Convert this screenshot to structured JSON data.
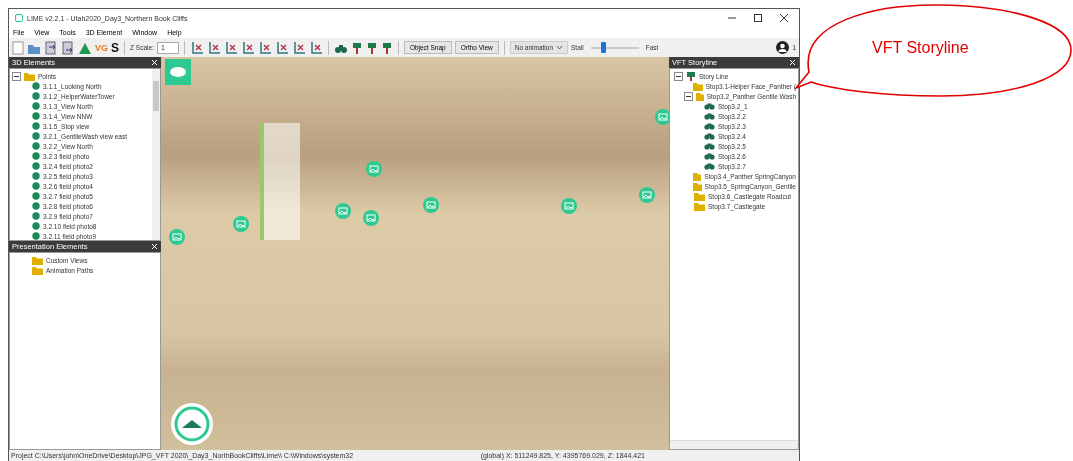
{
  "window": {
    "title": "LIME v2.2.1 - Utah2020_Day3_Northern Book Cliffs"
  },
  "menu": [
    "File",
    "View",
    "Tools",
    "3D Element",
    "Window",
    "Help"
  ],
  "toolbar": {
    "glyphs": [
      {
        "kind": "vg",
        "text": "VG"
      },
      {
        "kind": "s",
        "text": "S"
      }
    ],
    "z_scale_label": "Z Scale:",
    "z_scale_value": "1",
    "buttons": [
      "Object Snap",
      "Ortho View"
    ],
    "animation": "No animation",
    "speed": {
      "min_label": "Stall",
      "max_label": "Fast",
      "level": 0.25
    },
    "user_count": "1"
  },
  "elements_panel": {
    "title": "3D Elements",
    "tree": [
      {
        "label": "Points",
        "expanded": true,
        "children": [
          {
            "label": "3.1.1_Looking North"
          },
          {
            "label": "3.1.2_HelperWaterTower"
          },
          {
            "label": "3.1.3_View North"
          },
          {
            "label": "3.1.4_View NNW"
          },
          {
            "label": "3.1.5_Stop view"
          },
          {
            "label": "3.2.1_GentileWash view east"
          },
          {
            "label": "3.2.2_View North"
          },
          {
            "label": "3.2.3 field photo"
          },
          {
            "label": "3.2.4 field photo2"
          },
          {
            "label": "3.2.5 field photo3"
          },
          {
            "label": "3.2.6 field photo4"
          },
          {
            "label": "3.2.7 field photo5"
          },
          {
            "label": "3.2.8 field photo6"
          },
          {
            "label": "3.2.9 field photo7"
          },
          {
            "label": "3.2.10 field photo8"
          },
          {
            "label": "3.2.11 field photo9"
          }
        ]
      }
    ]
  },
  "presentation_panel": {
    "title": "Presentation Elements",
    "items": [
      "Custom Views",
      "Animation Paths"
    ]
  },
  "storyline_panel": {
    "title": "VFT Storyline",
    "tree": [
      {
        "label": "Story Line",
        "kind": "root",
        "expanded": true,
        "children": [
          {
            "label": "Stop3.1-Helper Face_Panther (",
            "kind": "folder"
          },
          {
            "label": "Stop3.2_Panther Gentile Wash",
            "kind": "folder",
            "expanded": true,
            "children": [
              {
                "label": "Stop3.2_1",
                "kind": "view"
              },
              {
                "label": "Stop3.2.2",
                "kind": "view"
              },
              {
                "label": "Stop3.2.3",
                "kind": "view"
              },
              {
                "label": "Stop3.2.4",
                "kind": "view"
              },
              {
                "label": "Stop3.2.5",
                "kind": "view"
              },
              {
                "label": "Stop3.2.6",
                "kind": "view"
              },
              {
                "label": "Stop3.2.7",
                "kind": "view"
              }
            ]
          },
          {
            "label": "Stop3.4_Panther SpringCanyon",
            "kind": "folder"
          },
          {
            "label": "Stop3.5_SpringCanyon_Gentile",
            "kind": "folder"
          },
          {
            "label": "Stop3.6_Castlegate Roadcut",
            "kind": "folder"
          },
          {
            "label": "Stop3.7_Castlegate",
            "kind": "folder"
          }
        ]
      }
    ]
  },
  "status_bar": {
    "project": "Project C:\\Users\\john\\OneDrive\\Desktop\\JPG_VFT 2020\\_Day3_NorthBookCliffs\\Lime\\\\ C:\\Windows\\system32",
    "coordinates": "(global) X: 511249.825, Y: 4395769.029, Z: 1844.421"
  },
  "callout": {
    "text": "VFT Storyline"
  }
}
